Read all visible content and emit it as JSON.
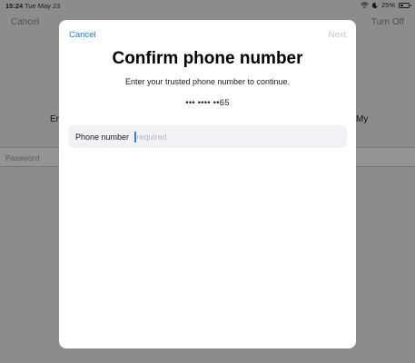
{
  "status_bar": {
    "time": "15:24",
    "date": "Tue May 23",
    "battery": "25%"
  },
  "background": {
    "cancel": "Cancel",
    "turn_off": "Turn Off",
    "left_fragment": "En",
    "right_fragment": "My",
    "password_placeholder": "Password"
  },
  "sheet": {
    "cancel": "Cancel",
    "next": "Next",
    "title": "Confirm phone number",
    "subtitle": "Enter your trusted phone number to continue.",
    "masked_number": "••• •••• ••65",
    "field_label": "Phone number",
    "field_placeholder": "required",
    "accent": "#1a7cf2"
  }
}
